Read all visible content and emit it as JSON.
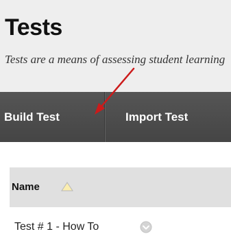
{
  "header": {
    "title": "Tests",
    "description": "Tests are a means of assessing student learning"
  },
  "toolbar": {
    "build_label": "Build Test",
    "import_label": "Import Test"
  },
  "table": {
    "columns": [
      {
        "label": "Name",
        "sort": "ascending",
        "sort_icon": "triangle-up-icon"
      }
    ],
    "rows": [
      {
        "title": "Test # 1 - How To",
        "menu_icon": "chevron-down-circle-icon"
      }
    ]
  },
  "annotation": {
    "arrow_color": "#cc1a1a",
    "arrow_target": "build-test-button"
  },
  "colors": {
    "header_bg": "#eeeeee",
    "toolbar_bg": "#4b4b4b",
    "table_header_bg": "#e0e0e0",
    "sort_icon_fill": "#fbeeb0",
    "arrow": "#cc1a1a"
  }
}
